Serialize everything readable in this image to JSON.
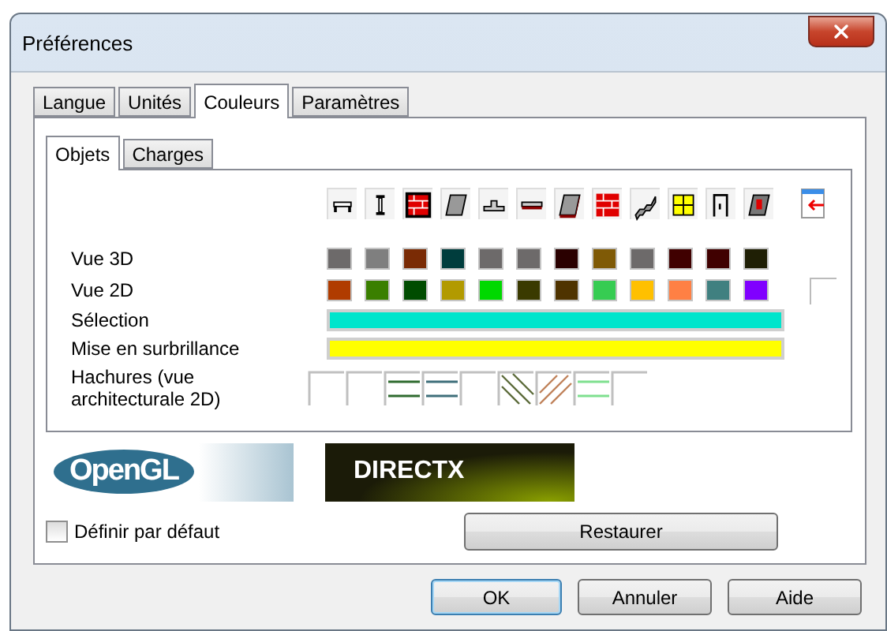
{
  "window": {
    "title": "Préférences"
  },
  "tabs": [
    {
      "label": "Langue",
      "selected": false
    },
    {
      "label": "Unités",
      "selected": false
    },
    {
      "label": "Couleurs",
      "selected": true
    },
    {
      "label": "Paramètres",
      "selected": false
    }
  ],
  "subtabs": [
    {
      "label": "Objets",
      "selected": true
    },
    {
      "label": "Charges",
      "selected": false
    }
  ],
  "rows": [
    {
      "kind": "swatches",
      "label": "Vue 3D",
      "swatches": [
        {
          "color": "#6d6a6a"
        },
        {
          "color": "#7f7f7f"
        },
        {
          "color": "#7a2b05"
        },
        {
          "color": "#003d3d"
        },
        {
          "color": "#6d6a6a"
        },
        {
          "color": "#6d6a6a"
        },
        {
          "color": "#2a0000"
        },
        {
          "color": "#7f5a06"
        },
        {
          "color": "#6d6a6a"
        },
        {
          "color": "#400000"
        },
        {
          "color": "#400000"
        },
        {
          "color": "#1f1f05"
        }
      ]
    },
    {
      "kind": "swatches",
      "label": "Vue 2D",
      "swatches": [
        {
          "color": "#b03c00"
        },
        {
          "color": "#3a7f00"
        },
        {
          "color": "#004c00"
        },
        {
          "color": "#b29a00"
        },
        {
          "color": "#00d900"
        },
        {
          "color": "#3a3a00"
        },
        {
          "color": "#4f3300"
        },
        {
          "color": "#36cc52"
        },
        {
          "color": "#ffc000"
        },
        {
          "color": "#ff8044"
        },
        {
          "color": "#408080"
        },
        {
          "color": "#8000ff"
        }
      ]
    },
    {
      "kind": "bar",
      "label": "Sélection",
      "color": "#00e5cc"
    },
    {
      "kind": "bar",
      "label": "Mise en surbrillance",
      "color": "#ffff00"
    },
    {
      "kind": "hatches",
      "label": "Hachures (vue architecturale 2D)",
      "hatches": [
        {
          "kind": "none"
        },
        {
          "kind": "none"
        },
        {
          "kind": "horizontal",
          "color": "#2f6b2f"
        },
        {
          "kind": "horizontal",
          "color": "#3f6f7a"
        },
        {
          "kind": "none"
        },
        {
          "kind": "diagonal-back",
          "color": "#5c6b3a"
        },
        {
          "kind": "diagonal-forward",
          "color": "#c0825a"
        },
        {
          "kind": "horizontal",
          "color": "#7fe08f"
        },
        {
          "kind": "none"
        }
      ]
    }
  ],
  "logos": [
    {
      "kind": "opengl",
      "text": "OpenGL"
    },
    {
      "kind": "directx",
      "text": "DIRECTX"
    }
  ],
  "default_checkbox": {
    "label": "Définir par défaut",
    "checked": false
  },
  "restore_button": "Restaurer",
  "buttons": [
    {
      "label": "OK",
      "default": true
    },
    {
      "label": "Annuler",
      "default": false
    },
    {
      "label": "Aide",
      "default": false
    }
  ]
}
